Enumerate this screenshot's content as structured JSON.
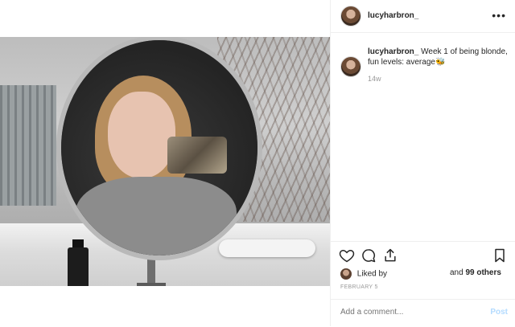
{
  "header": {
    "username": "lucyharbron_",
    "more_label": "•••"
  },
  "caption": {
    "username": "lucyharbron_",
    "text": "Week 1 of being blonde, fun levels: average🐝",
    "time": "14w"
  },
  "likes": {
    "prefix": "Liked by",
    "suffix_and": "and",
    "suffix_count": "99 others"
  },
  "date": "FEBRUARY 5",
  "comment": {
    "placeholder": "Add a comment...",
    "post_label": "Post"
  },
  "colors": {
    "border": "#efefef",
    "muted": "#999999",
    "post": "#b3dbff"
  }
}
